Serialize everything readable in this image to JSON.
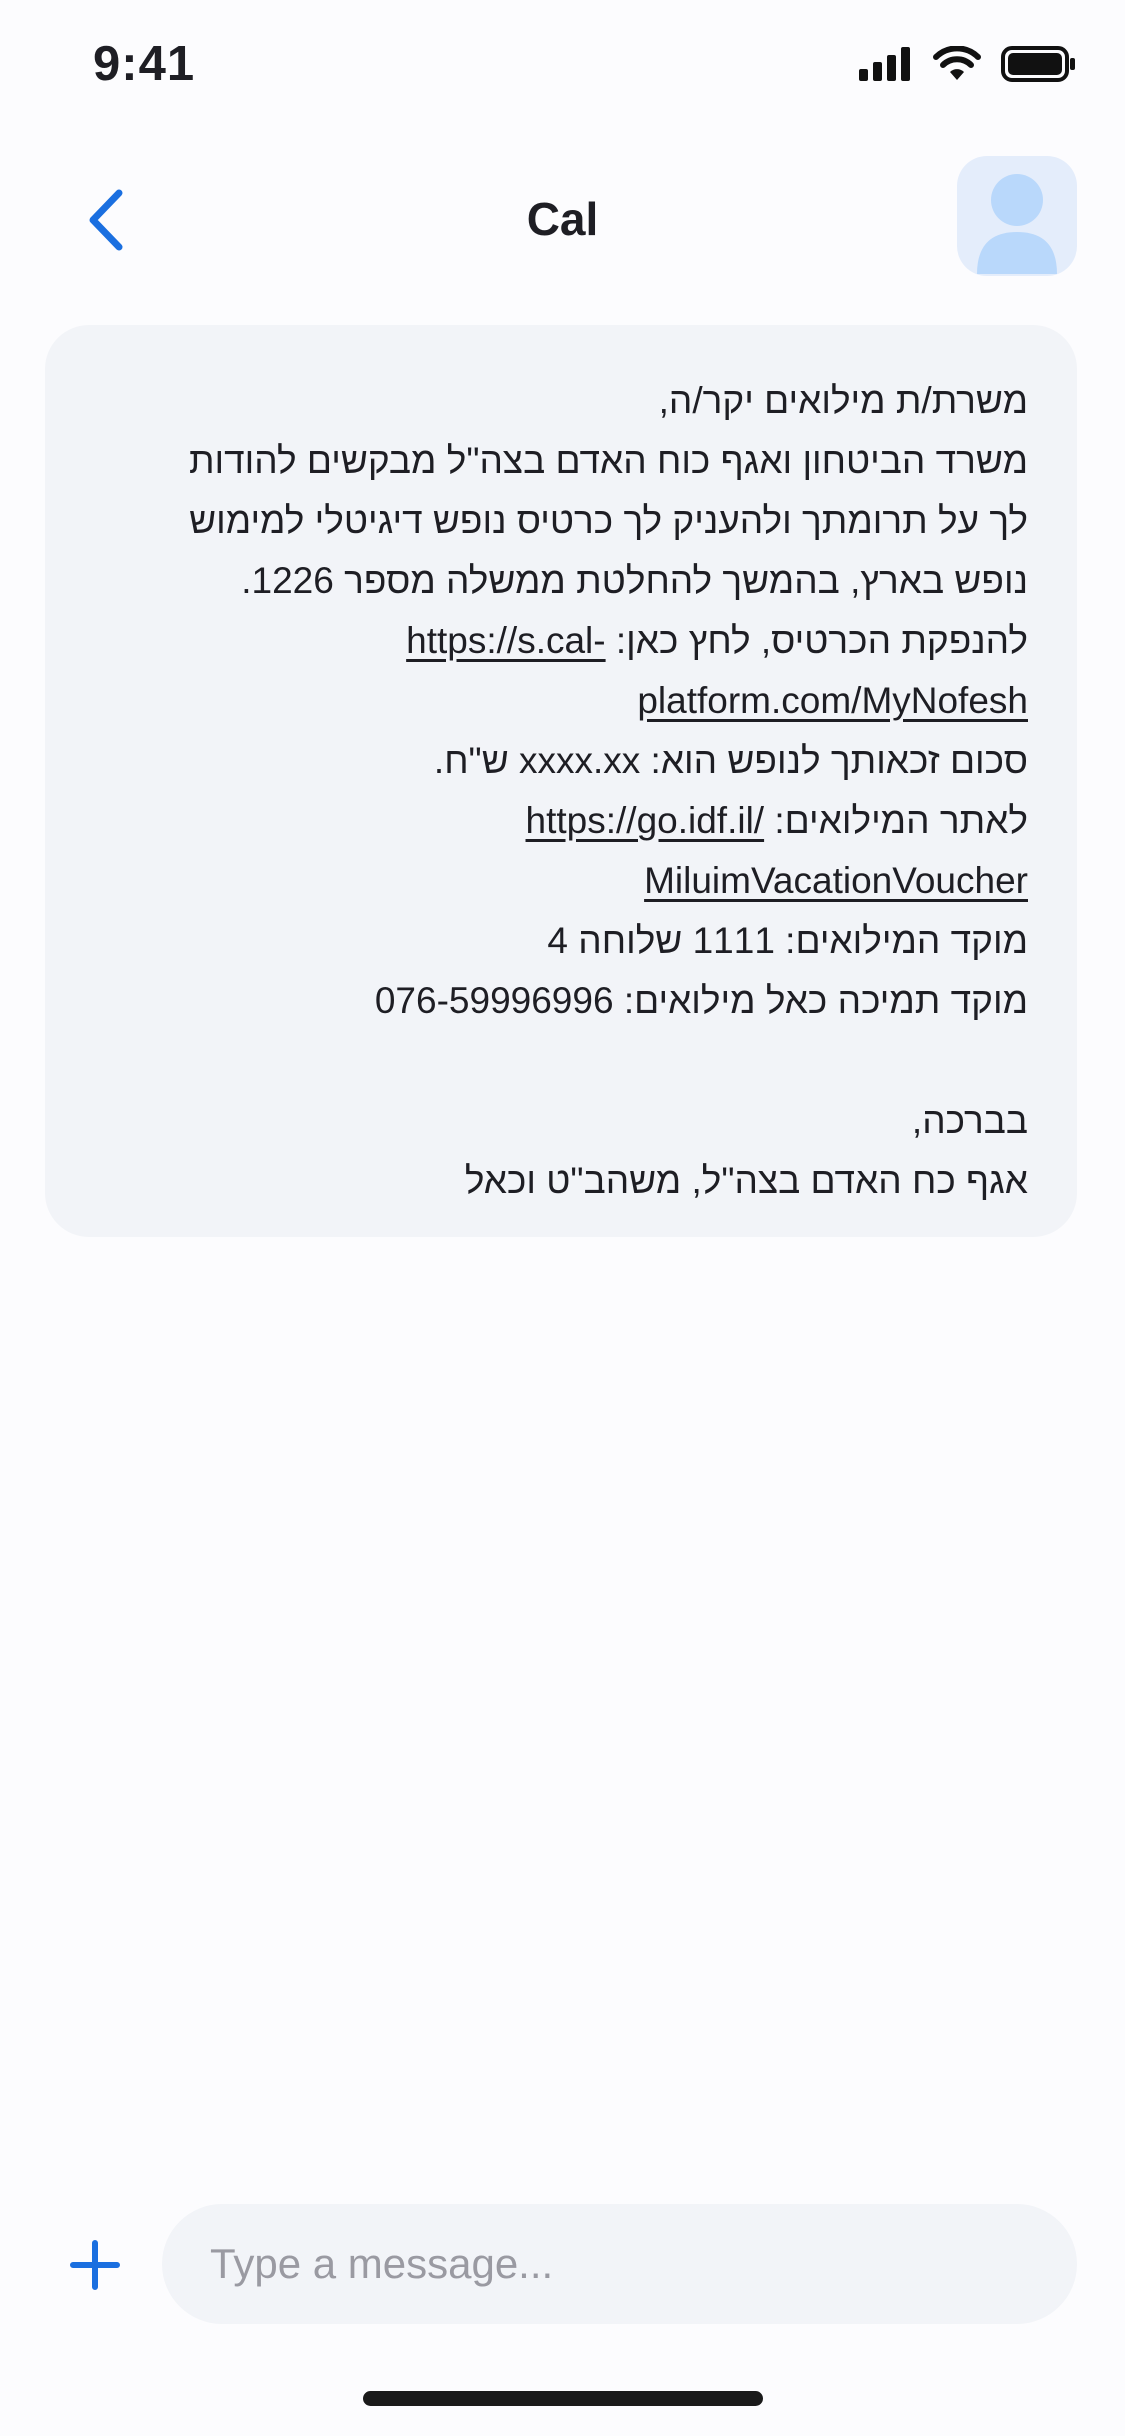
{
  "status_bar": {
    "time": "9:41",
    "icons": [
      "signal-icon",
      "wifi-icon",
      "battery-icon"
    ]
  },
  "header": {
    "title": "Cal",
    "back_icon": "chevron-left-icon",
    "avatar_icon": "person-icon"
  },
  "message": {
    "lines": [
      {
        "text": "משרת/ת מילואים יקר/ה,"
      },
      {
        "text": "משרד הביטחון ואגף כוח האדם בצה\"ל מבקשים להודות"
      },
      {
        "text": "לך על תרומתך ולהעניק לך כרטיס נופש דיגיטלי למימוש"
      },
      {
        "text": "נופש בארץ, בהמשך להחלטת ממשלה מספר 1226."
      },
      {
        "text": "להנפקת הכרטיס, לחץ כאן: ",
        "link": "https://s.cal-"
      },
      {
        "link": "platform.com/MyNofesh"
      },
      {
        "text": "סכום זכאותך לנופש הוא: xxxx.xx ש\"ח."
      },
      {
        "text": "לאתר המילואים: ",
        "link": "https://go.idf.il/"
      },
      {
        "link": "MiluimVacationVoucher"
      },
      {
        "text": "מוקד המילואים: 1111 שלוחה 4"
      },
      {
        "text": "מוקד תמיכה כאל מילואים: 076-59996996"
      },
      {
        "text": ""
      },
      {
        "text": "בברכה,"
      },
      {
        "text": "אגף כח האדם בצה\"ל, משהב\"ט וכאל"
      }
    ]
  },
  "composer": {
    "plus_icon": "plus-icon",
    "placeholder": "Type a message..."
  },
  "colors": {
    "accent": "#1A6FE0",
    "bubble": "#F2F4F8",
    "avatar_bg": "#E4EDFB",
    "avatar_fg": "#B9D8FB"
  }
}
